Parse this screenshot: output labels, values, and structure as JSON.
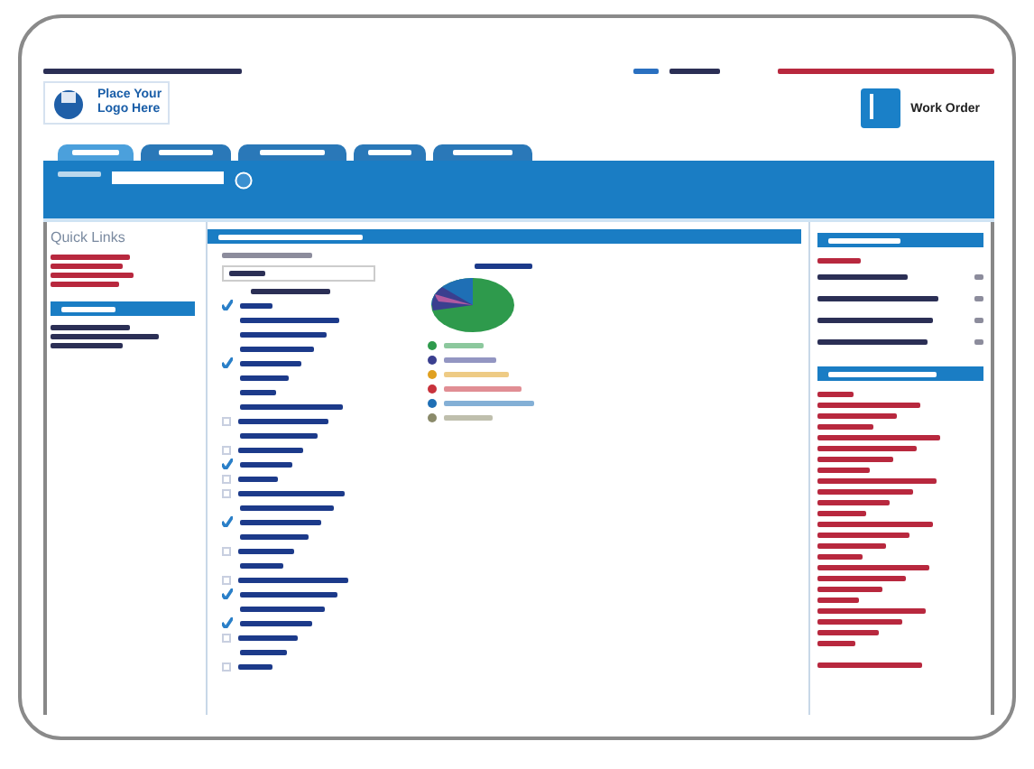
{
  "header": {
    "logo_text": [
      "Place Your",
      "Logo Here"
    ],
    "work_order_label": "Work Order"
  },
  "tabs": [
    {
      "selected": true
    },
    {
      "selected": false
    },
    {
      "selected": false
    },
    {
      "selected": false
    },
    {
      "selected": false
    }
  ],
  "quick_links": {
    "title": "Quick Links"
  },
  "tree": {
    "rows": [
      {
        "kind": "box",
        "checked": true
      },
      {
        "kind": "plain"
      },
      {
        "kind": "plain"
      },
      {
        "kind": "plain"
      },
      {
        "kind": "box",
        "checked": true
      },
      {
        "kind": "plain"
      },
      {
        "kind": "plain"
      },
      {
        "kind": "plain"
      },
      {
        "kind": "box",
        "checked": false
      },
      {
        "kind": "plain"
      },
      {
        "kind": "box",
        "checked": false
      },
      {
        "kind": "box",
        "checked": true
      },
      {
        "kind": "box",
        "checked": false
      },
      {
        "kind": "box",
        "checked": false
      },
      {
        "kind": "plain"
      },
      {
        "kind": "box",
        "checked": true
      },
      {
        "kind": "plain"
      },
      {
        "kind": "box",
        "checked": false
      },
      {
        "kind": "plain"
      },
      {
        "kind": "box",
        "checked": false
      },
      {
        "kind": "box",
        "checked": true
      },
      {
        "kind": "plain"
      },
      {
        "kind": "box",
        "checked": true
      },
      {
        "kind": "box",
        "checked": false
      },
      {
        "kind": "plain"
      },
      {
        "kind": "box",
        "checked": false
      }
    ]
  },
  "chart": {
    "legend": [
      {
        "color": "#2e9a4c"
      },
      {
        "color": "#3a3f8f"
      },
      {
        "color": "#e0a020"
      },
      {
        "color": "#c8323c"
      },
      {
        "color": "#1f6fb5"
      },
      {
        "color": "#8a8a6a"
      }
    ]
  }
}
